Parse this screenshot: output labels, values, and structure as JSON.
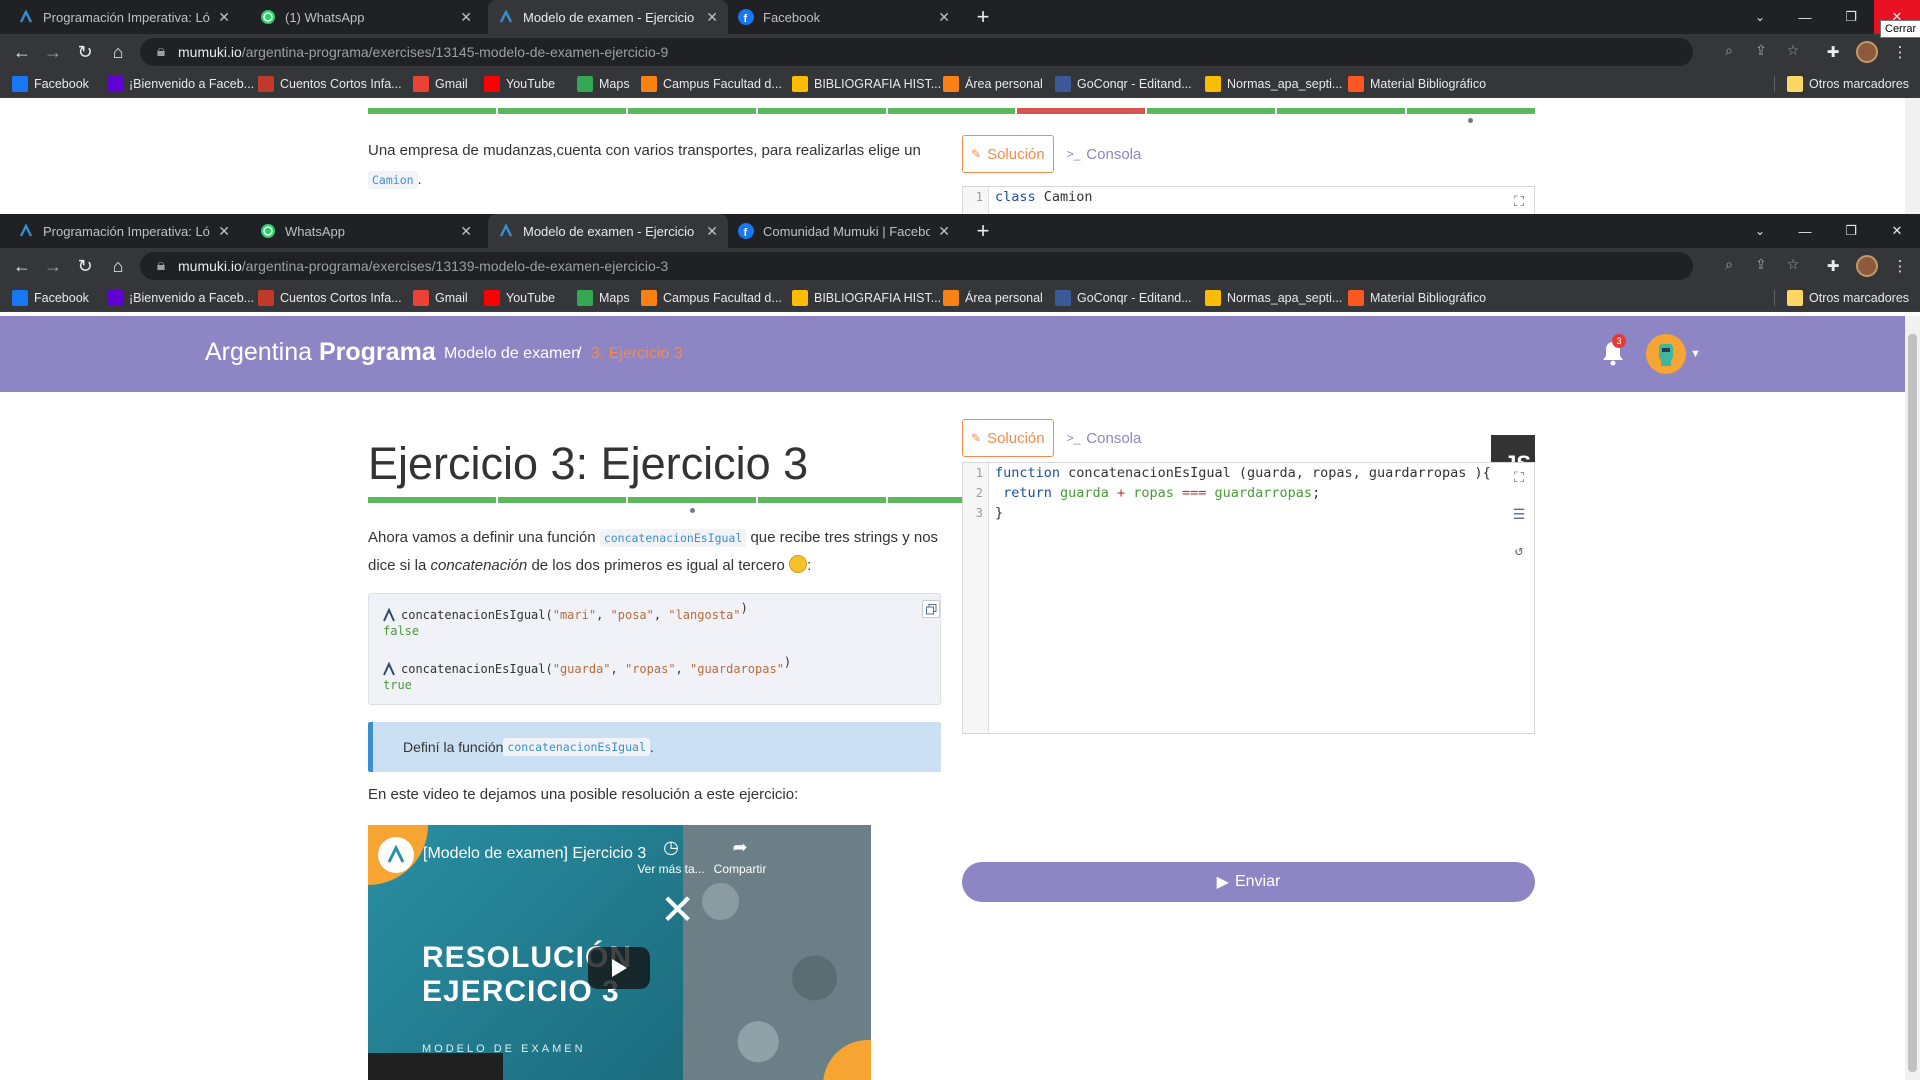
{
  "window_top": {
    "tabs": [
      {
        "title": "Programación Imperativa: Lógica",
        "icon": "mumuki-icon",
        "active": false
      },
      {
        "title": "(1) WhatsApp",
        "icon": "whatsapp-icon",
        "active": false
      },
      {
        "title": "Modelo de examen - Ejercicio 9",
        "icon": "mumuki-icon",
        "active": true
      },
      {
        "title": "Facebook",
        "icon": "facebook-icon",
        "active": false
      }
    ],
    "url_host": "mumuki.io",
    "url_path": "/argentina-programa/exercises/13145-modelo-de-examen-ejercicio-9",
    "close_tooltip": "Cerrar",
    "content": {
      "desc_line1": "Una empresa de mudanzas,cuenta con varios transportes, para realizarlas elige un",
      "desc_code": "Camion",
      "desc_after_code": ".",
      "tab_solution": "Solución",
      "tab_console": "Consola",
      "code_line_num": "1",
      "code_kw": "class",
      "code_rest": " Camion"
    }
  },
  "window_main": {
    "tabs": [
      {
        "title": "Programación Imperativa: Lógica",
        "icon": "mumuki-icon",
        "active": false
      },
      {
        "title": "WhatsApp",
        "icon": "whatsapp-icon",
        "active": false
      },
      {
        "title": "Modelo de examen - Ejercicio 3",
        "icon": "mumuki-icon",
        "active": true
      },
      {
        "title": "Comunidad Mumuki | Facebook",
        "icon": "facebook-icon",
        "active": false
      }
    ],
    "url_host": "mumuki.io",
    "url_path": "/argentina-programa/exercises/13139-modelo-de-examen-ejercicio-3"
  },
  "bookmarks": [
    {
      "label": "Facebook",
      "icon": "facebook-icon",
      "color": "#1877f2"
    },
    {
      "label": "¡Bienvenido a Faceb...",
      "icon": "yahoo-icon",
      "color": "#6001d2"
    },
    {
      "label": "Cuentos Cortos Infa...",
      "icon": "site-icon",
      "color": "#c0392b"
    },
    {
      "label": "Gmail",
      "icon": "gmail-icon",
      "color": "#ea4335"
    },
    {
      "label": "YouTube",
      "icon": "youtube-icon",
      "color": "#ff0000"
    },
    {
      "label": "Maps",
      "icon": "maps-icon",
      "color": "#34a853"
    },
    {
      "label": "Campus Facultad d...",
      "icon": "moodle-icon",
      "color": "#f98012"
    },
    {
      "label": "BIBLIOGRAFIA HIST...",
      "icon": "drive-icon",
      "color": "#fbbc04"
    },
    {
      "label": "Área personal",
      "icon": "moodle-icon",
      "color": "#f98012"
    },
    {
      "label": "GoConqr - Editand...",
      "icon": "goconqr-icon",
      "color": "#3b5998"
    },
    {
      "label": "Normas_apa_septi...",
      "icon": "drive-icon",
      "color": "#fbbc04"
    },
    {
      "label": "Material Bibliográfico",
      "icon": "blogger-icon",
      "color": "#ff5722"
    }
  ],
  "other_bookmarks": "Otros marcadores",
  "navbar": {
    "brand_light": "Argentina",
    "brand_bold": "Programa",
    "crumb_sep": "/",
    "crumb_1": "Modelo de examen",
    "crumb_2": "3. Ejercicio 3",
    "notifications_count": "3"
  },
  "exercise": {
    "title": "Ejercicio 3: Ejercicio 3",
    "language_badge": "JS",
    "progress": {
      "total": 9,
      "current_index": 2,
      "failed_index": 5
    },
    "desc_part1": "Ahora vamos a definir una función ",
    "desc_code": "concatenacionEsIgual",
    "desc_part2": " que recibe tres strings y nos dice si la ",
    "desc_em": "concatenación",
    "desc_part3": " de los dos primeros es igual al tercero ",
    "examples": [
      {
        "fn": "concatenacionEsIgual(",
        "args": [
          "\"mari\"",
          "\"posa\"",
          "\"langosta\""
        ],
        "result": "false"
      },
      {
        "fn": "concatenacionEsIgual(",
        "args": [
          "\"guarda\"",
          "\"ropas\"",
          "\"guardaropas\""
        ],
        "result": "true"
      }
    ],
    "tip_text": "Definí la función ",
    "tip_code": "concatenacionEsIgual",
    "tip_end": ".",
    "video_label": "En este video te dejamos una posible resolución a este ejercicio:",
    "video": {
      "title": "[Modelo de examen] Ejercicio 3",
      "watch_later": "Ver más ta...",
      "share": "Compartir",
      "big_line1": "RESOLUCIÓN",
      "big_line2": "EJERCICIO 3",
      "subtitle": "MODELO DE EXAMEN"
    }
  },
  "editor": {
    "tab_solution": "Solución",
    "tab_console": "Consola",
    "line_numbers": [
      "1",
      "2",
      "3"
    ],
    "line1": {
      "kw": "function",
      "rest": " concatenacionEsIgual (guarda, ropas, guardarropas ){"
    },
    "line2": {
      "indent": " ",
      "kw": "return",
      "a": " guarda ",
      "op1": "+",
      "b": " ropas ",
      "op2": "===",
      "c": " guardarropas",
      "end": ";"
    },
    "line3": "}",
    "submit_label": "Enviar"
  }
}
